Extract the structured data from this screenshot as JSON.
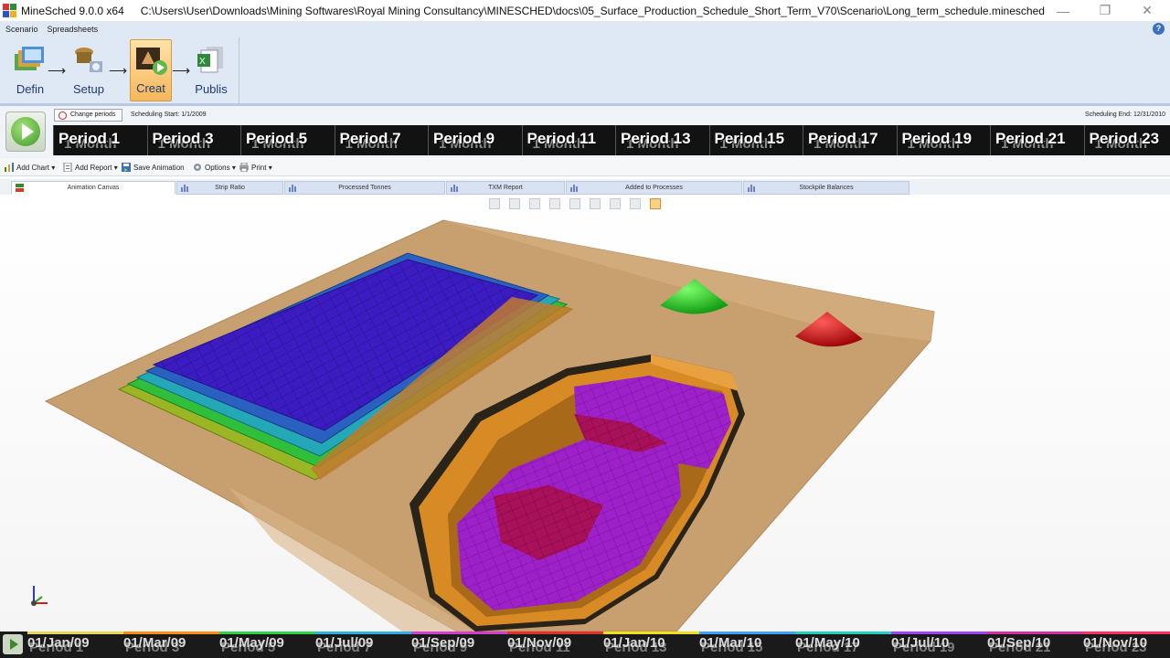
{
  "window": {
    "title": "MineSched 9.0.0 x64",
    "path": "C:\\Users\\User\\Downloads\\Mining Softwares\\Royal Mining Consultancy\\MINESCHED\\docs\\05_Surface_Production_Schedule_Short_Term_V70\\Scenario\\Long_term_schedule.minesched",
    "minimize_glyph": "—",
    "restore_glyph": "❐",
    "close_glyph": "✕"
  },
  "menu": [
    "Scenario",
    "Spreadsheets"
  ],
  "help_glyph": "?",
  "ribbon": {
    "buttons": [
      {
        "label": "Defin",
        "icon": "define-icon"
      },
      {
        "label": "Setup",
        "icon": "setup-icon"
      },
      {
        "label": "Creat",
        "icon": "create-icon",
        "active": true
      },
      {
        "label": "Publis",
        "icon": "publish-icon"
      }
    ],
    "arrow_glyph": "⟶"
  },
  "schedule": {
    "change_periods_label": "Change periods",
    "start_label": "Scheduling Start: 1/1/2009",
    "end_label": "Scheduling End: 12/31/2010",
    "periods": [
      "Period 1",
      "Period 3",
      "Period 5",
      "Period 7",
      "Period 9",
      "Period 11",
      "Period 13",
      "Period 15",
      "Period 17",
      "Period 19",
      "Period 21",
      "Period 23"
    ],
    "period_unit": "1 Month"
  },
  "toolbar": {
    "add_chart": "Add Chart",
    "add_report": "Add Report",
    "save_animation": "Save Animation",
    "options": "Options",
    "print": "Print",
    "dropdown_glyph": "▾"
  },
  "tabs": [
    "Animation Canvas",
    "Strip Ratio",
    "Processed Tonnes",
    "TXM Report",
    "Added to Processes",
    "Stockpile Balances"
  ],
  "timeline": {
    "dates": [
      "01/Jan/09",
      "01/Mar/09",
      "01/May/09",
      "01/Jul/09",
      "01/Sep/09",
      "01/Nov/09",
      "01/Jan/10",
      "01/Mar/10",
      "01/May/10",
      "01/Jul/10",
      "01/Sep/10",
      "01/Nov/10"
    ],
    "periods": [
      "Period 1",
      "Period 3",
      "Period 5",
      "Period 7",
      "Period 9",
      "Period 11",
      "Period 13",
      "Period 15",
      "Period 17",
      "Period 19",
      "Period 21",
      "Period 23"
    ],
    "colors": [
      "#e6d95a",
      "#ff8c1a",
      "#2fd24a",
      "#2fb0e0",
      "#d040d0",
      "#e03030",
      "#f0e020",
      "#40a0ff",
      "#20d0c0",
      "#a040ff",
      "#d030a0",
      "#ff3060"
    ]
  },
  "colors": {
    "ground": "#c49a6c",
    "waste_dump_top": "#3418b8",
    "ore_pit": "#9a1fc4",
    "stockpile_green": "#2fcf2f",
    "stockpile_red": "#d81818"
  }
}
